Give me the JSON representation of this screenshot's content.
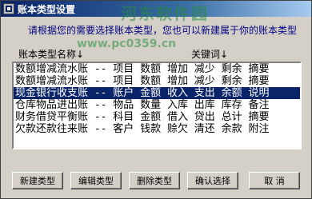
{
  "window": {
    "title": "账本类型设置"
  },
  "hint": "请根据您的需要选择账本类型，您也可以新建属于你的账本类型",
  "columns": {
    "name": "账本类型名称↓",
    "keywords": "关键词↓"
  },
  "rows": [
    "数额增减流水账 -- 项目 数额 增加 减少 剩余 摘要",
    "数额增减流水账 -- 项目 数额 增加 减少 剩余 摘要",
    "现金银行收支账 -- 账户 金额 收入 支出 余额 说明",
    "仓库物品进出账 -- 物品 数量 入库 出库 库存 备注",
    "财务借贷平衡账 -- 科目 金额 借入 贷出 总计 摘要",
    "欠款还款往来账 -- 客户 钱款 赊欠 清还 余款 附注"
  ],
  "selected_row": 2,
  "buttons": {
    "new": "新建类型",
    "edit": "编辑类型",
    "delete": "删除类型",
    "confirm": "确认选择",
    "exit": "取 消"
  },
  "watermark": {
    "line1": "河东软件园",
    "line2": "www.pc0359.cn"
  }
}
